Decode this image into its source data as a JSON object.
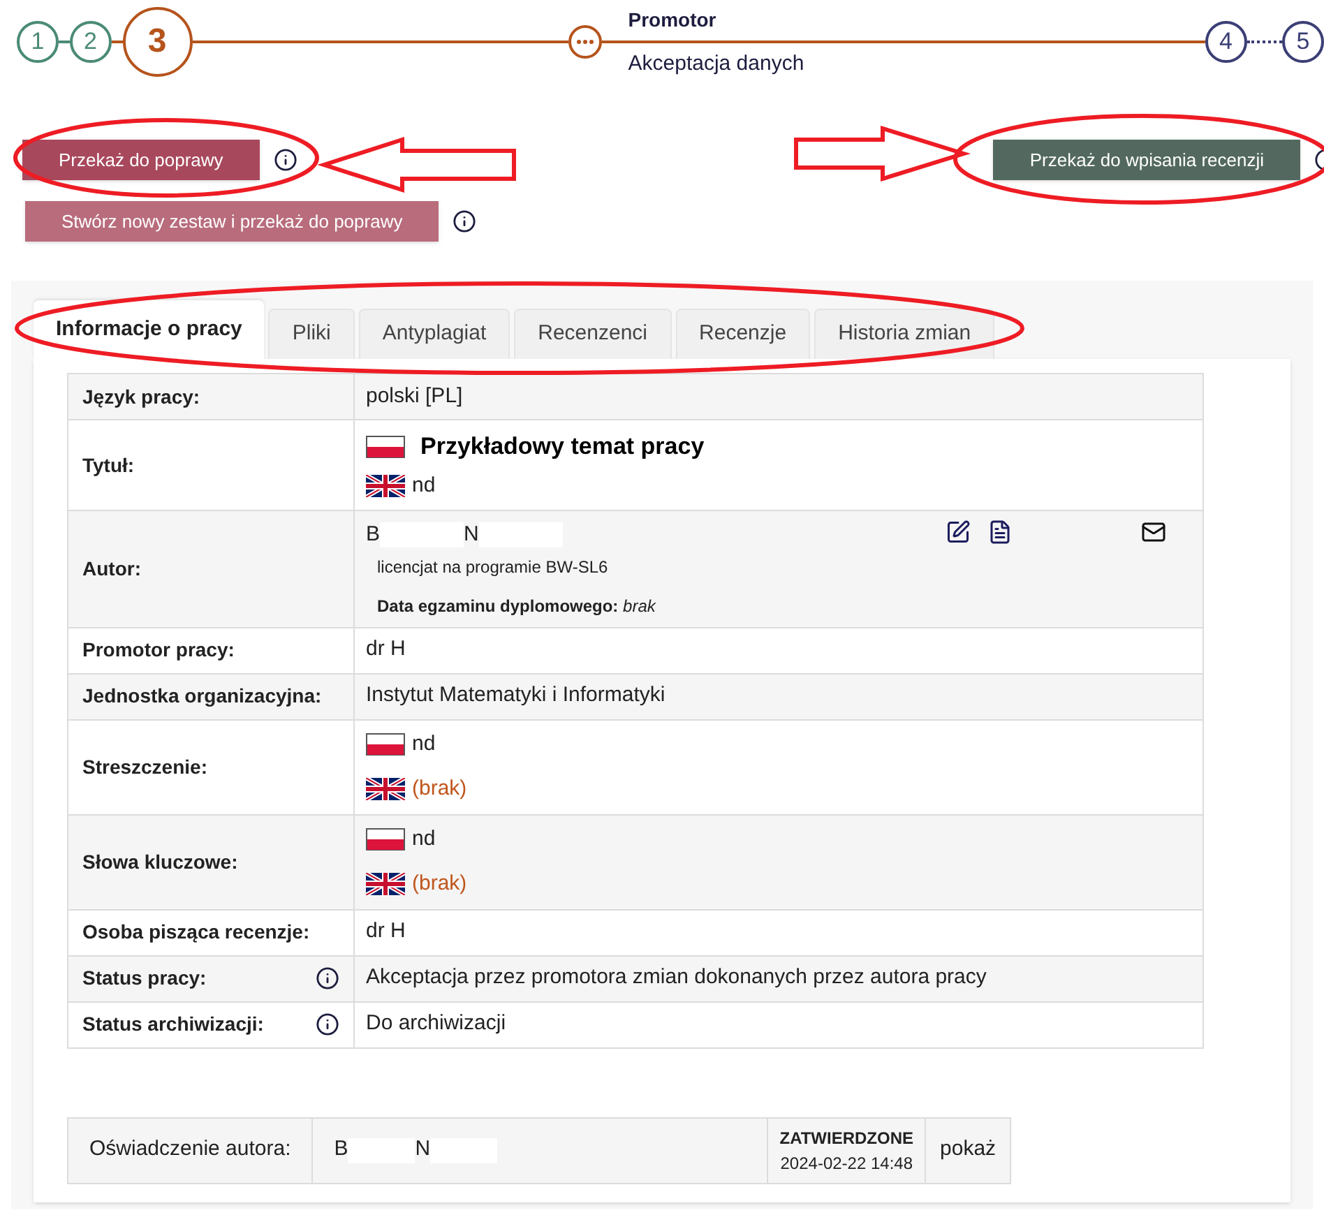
{
  "stepper": {
    "steps_before": [
      {
        "label": "1",
        "kind": "done"
      },
      {
        "label": "2",
        "kind": "done"
      },
      {
        "label": "3",
        "kind": "current"
      }
    ],
    "stage": {
      "title": "Promotor",
      "subtitle": "Akceptacja danych"
    },
    "steps_after": [
      {
        "label": "4",
        "kind": "pending"
      },
      {
        "label": "5",
        "kind": "pending"
      }
    ]
  },
  "actions_left": [
    {
      "label": "Przekaż do poprawy",
      "kind": "reject"
    },
    {
      "label": "Stwórz nowy zestaw i przekaż do poprawy",
      "kind": "reject_light"
    }
  ],
  "actions_right": [
    {
      "label": "Przekaż do wpisania recenzji",
      "kind": "accept"
    }
  ],
  "tabs": [
    {
      "label": "Informacje o pracy",
      "selected": true
    },
    {
      "label": "Pliki",
      "selected": false
    },
    {
      "label": "Antyplagiat",
      "selected": false
    },
    {
      "label": "Recenzenci",
      "selected": false
    },
    {
      "label": "Recenzje",
      "selected": false
    },
    {
      "label": "Historia zmian",
      "selected": false
    }
  ],
  "details": [
    {
      "label": "Język pracy:",
      "info": false,
      "kind": "text",
      "value": "polski [PL]"
    },
    {
      "label": "Tytuł:",
      "info": false,
      "kind": "title",
      "entries": [
        {
          "kind": "pl",
          "text": "Przykładowy temat pracy",
          "missing": false
        },
        {
          "kind": "en",
          "text": "nd",
          "missing": false
        }
      ]
    },
    {
      "label": "Autor:",
      "info": false,
      "kind": "author",
      "name_parts": [
        "B",
        "N"
      ],
      "program": "licencjat na programie BW-SL6",
      "exam_label": "Data egzaminu dyplomowego:",
      "exam_value": "brak"
    },
    {
      "label": "Promotor pracy:",
      "info": false,
      "kind": "text",
      "value": "dr H"
    },
    {
      "label": "Jednostka organizacyjna:",
      "info": false,
      "kind": "text",
      "value": "Instytut Matematyki i Informatyki"
    },
    {
      "label": "Streszczenie:",
      "info": false,
      "kind": "flags",
      "entries": [
        {
          "kind": "pl",
          "text": "nd",
          "missing": false
        },
        {
          "kind": "en",
          "text": "(brak)",
          "missing": true
        }
      ]
    },
    {
      "label": "Słowa kluczowe:",
      "info": false,
      "kind": "flags",
      "entries": [
        {
          "kind": "pl",
          "text": "nd",
          "missing": false
        },
        {
          "kind": "en",
          "text": "(brak)",
          "missing": true
        }
      ]
    },
    {
      "label": "Osoba pisząca recenzje:",
      "info": false,
      "kind": "text",
      "value": "dr H"
    },
    {
      "label": "Status pracy:",
      "info": true,
      "kind": "text",
      "value": "Akceptacja przez promotora zmian dokonanych przez autora pracy"
    },
    {
      "label": "Status archiwizacji:",
      "info": true,
      "kind": "text",
      "value": "Do archiwizacji"
    }
  ],
  "declaration": {
    "label": "Oświadczenie autora:",
    "name_parts": [
      "B",
      "N"
    ],
    "status": "ZATWIERDZONE",
    "date": "2024-02-22 14:48",
    "link": "pokaż"
  }
}
